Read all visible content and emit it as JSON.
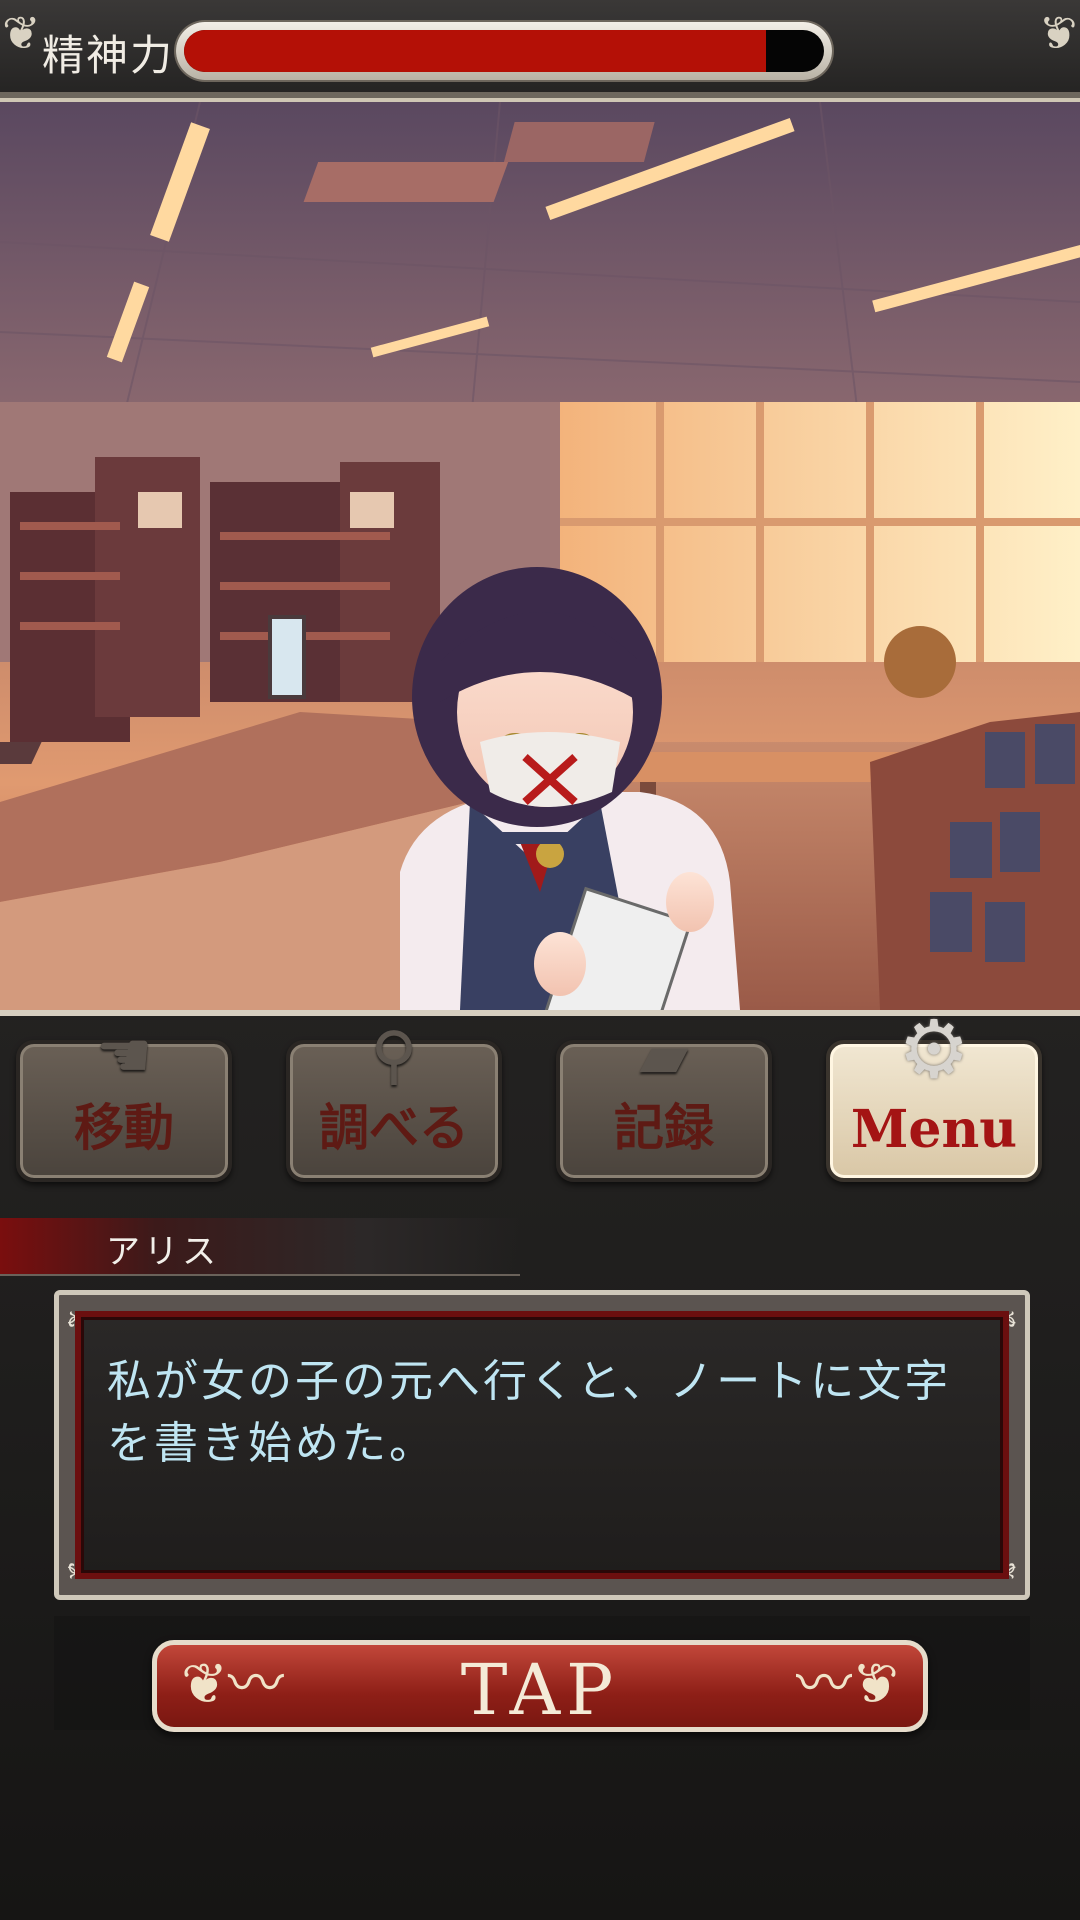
{
  "status_bar": {
    "sanity_label": "精神力",
    "sanity_level_percent": 91,
    "sanity_color": "#b41006"
  },
  "scene": {
    "background": "school-library",
    "character": "masked-girl-with-notebook"
  },
  "commands": [
    {
      "label": "移動",
      "icon": "pointing-hand-icon"
    },
    {
      "label": "調べる",
      "icon": "magnifier-icon"
    },
    {
      "label": "記録",
      "icon": "folder-icon"
    },
    {
      "label": "Menu",
      "icon": "gear-icon"
    }
  ],
  "dialogue": {
    "speaker": "アリス",
    "text": "私が女の子の元へ行くと、ノートに文字を書き始めた。"
  },
  "tap": {
    "label": "TAP"
  },
  "colors": {
    "accent_red": "#8e1f17",
    "dialog_text": "#bfe5f2",
    "frame": "#cfc8ba"
  }
}
